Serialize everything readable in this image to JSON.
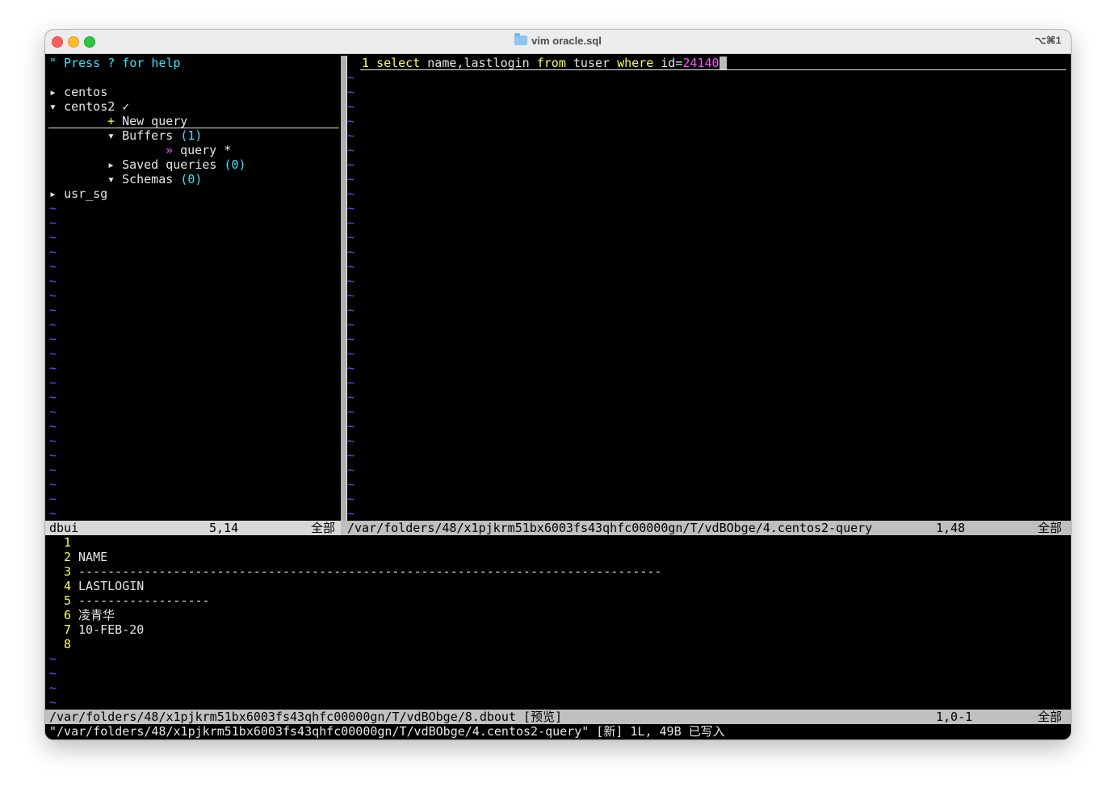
{
  "window": {
    "title": "vim oracle.sql",
    "shortcut": "⌥⌘1"
  },
  "dbui": {
    "help": "\" Press ? for help",
    "items": [
      {
        "marker": "▸",
        "label": "centos"
      },
      {
        "marker": "▾",
        "label": "centos2 ✓"
      },
      {
        "marker": "+",
        "label": "New query"
      },
      {
        "marker": "▾",
        "label": "Buffers",
        "count": "(1)"
      },
      {
        "marker": "»",
        "label": "query *"
      },
      {
        "marker": "▸",
        "label": "Saved queries",
        "count": "(0)"
      },
      {
        "marker": "▾",
        "label": "Schemas",
        "count": "(0)"
      },
      {
        "marker": "▸",
        "label": "usr_sg"
      }
    ],
    "status": {
      "name": "dbui",
      "pos": "5,14",
      "pct": "全部"
    }
  },
  "editor": {
    "line_number": "1",
    "tokens": {
      "select": "select",
      "cols": "name,lastlogin",
      "from": "from",
      "table": "tuser",
      "where": "where",
      "cond": "id=",
      "value": "24140"
    },
    "status": {
      "path": "/var/folders/48/x1pjkrm51bx6003fs43qhfc00000gn/T/vdBObge/4.centos2-query",
      "pos": "1,48",
      "pct": "全部"
    }
  },
  "output": {
    "lines": [
      {
        "num": "1",
        "text": ""
      },
      {
        "num": "2",
        "text": "NAME"
      },
      {
        "num": "3",
        "text": "--------------------------------------------------------------------------------"
      },
      {
        "num": "4",
        "text": "LASTLOGIN"
      },
      {
        "num": "5",
        "text": "------------------"
      },
      {
        "num": "6",
        "text": "凌青华"
      },
      {
        "num": "7",
        "text": "10-FEB-20"
      },
      {
        "num": "8",
        "text": ""
      }
    ],
    "status": {
      "path": "/var/folders/48/x1pjkrm51bx6003fs43qhfc00000gn/T/vdBObge/8.dbout [预览]",
      "pos": "1,0-1",
      "pct": "全部"
    }
  },
  "cmdline": "\"/var/folders/48/x1pjkrm51bx6003fs43qhfc00000gn/T/vdBObge/4.centos2-query\" [新] 1L, 49B 已写入",
  "tilde": "~"
}
